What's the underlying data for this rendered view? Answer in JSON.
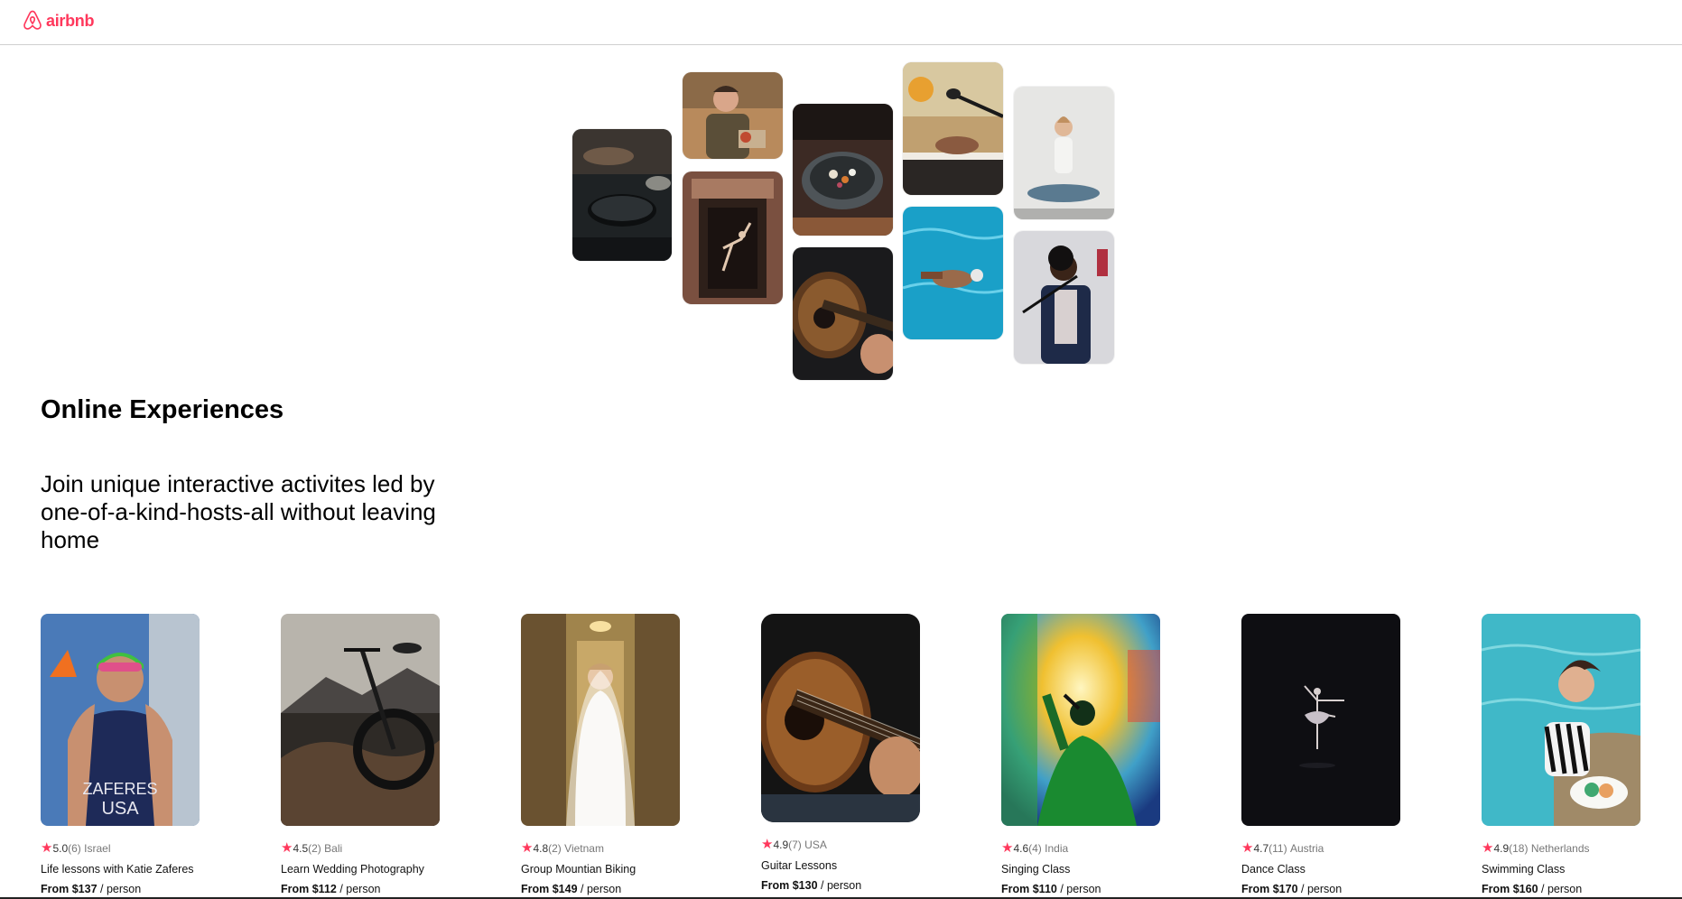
{
  "navbar": {
    "logo_text": "airbnb",
    "logo_icon": "airbnb-belo-icon",
    "brand_color": "#ff385c"
  },
  "hero": {
    "tiles": [
      {
        "name": "cooking-pans-photo"
      },
      {
        "name": "chef-woman-photo"
      },
      {
        "name": "dancer-doorway-photo"
      },
      {
        "name": "food-bowl-photo"
      },
      {
        "name": "guitar-closeup-photo"
      },
      {
        "name": "microphone-piano-photo"
      },
      {
        "name": "swimmer-pool-photo"
      },
      {
        "name": "yoga-woman-photo"
      },
      {
        "name": "singer-stage-photo"
      }
    ]
  },
  "section": {
    "title": "Online Experiences",
    "subtitle": "Join unique interactive activites led by one-of-a-kind-hosts-all without leaving home"
  },
  "cards": [
    {
      "rating": "5.0",
      "review_count": "(6)",
      "location": "Israel",
      "title": "Life lessons with Katie Zaferes",
      "price_prefix": "From",
      "price": "$137",
      "price_suffix": " / person",
      "photo": "swimmer-athlete-photo"
    },
    {
      "rating": "4.5",
      "review_count": "(2)",
      "location": "Bali",
      "title": "Learn Wedding Photography",
      "price_prefix": "From",
      "price": "$112",
      "price_suffix": " / person",
      "photo": "mountain-bike-photo"
    },
    {
      "rating": "4.8",
      "review_count": "(2)",
      "location": "Vietnam",
      "title": "Group Mountian Biking",
      "price_prefix": "From",
      "price": "$149",
      "price_suffix": " / person",
      "photo": "bride-veil-photo"
    },
    {
      "rating": "4.9",
      "review_count": "(7)",
      "location": "USA",
      "title": "Guitar Lessons",
      "price_prefix": "From",
      "price": "$130",
      "price_suffix": " / person",
      "photo": "acoustic-guitar-photo"
    },
    {
      "rating": "4.6",
      "review_count": "(4)",
      "location": "India",
      "title": "Singing Class",
      "price_prefix": "From",
      "price": "$110",
      "price_suffix": " / person",
      "photo": "concert-singer-photo"
    },
    {
      "rating": "4.7",
      "review_count": "(11)",
      "location": "Austria",
      "title": "Dance Class",
      "price_prefix": "From",
      "price": "$170",
      "price_suffix": " / person",
      "photo": "ballet-dancer-photo"
    },
    {
      "rating": "4.9",
      "review_count": "(18)",
      "location": "Netherlands",
      "title": "Swimming Class",
      "price_prefix": "From",
      "price": "$160",
      "price_suffix": " / person",
      "photo": "pool-woman-photo"
    }
  ]
}
